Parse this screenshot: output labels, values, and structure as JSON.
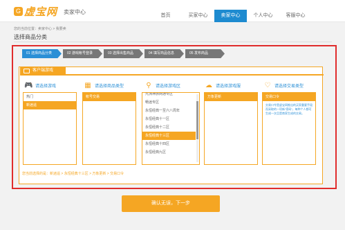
{
  "header": {
    "logo_glyph": "G",
    "logo_text": "虚宝网",
    "sub_title": "卖家中心",
    "nav": [
      {
        "label": "首页"
      },
      {
        "label": "买家中心"
      },
      {
        "label": "卖家中心",
        "active": true
      },
      {
        "label": "个人中心"
      },
      {
        "label": "客服中心"
      }
    ]
  },
  "breadcrumb": "您的当前位置：卖家中心 > 我要卖",
  "page_title": "选择商品分类",
  "steps": [
    {
      "label": "01 选择商品分类",
      "active": true
    },
    {
      "label": "02 游戏帐号登录"
    },
    {
      "label": "03 选择出售商品"
    },
    {
      "label": "04 填写商品信息"
    },
    {
      "label": "05 发布商品"
    }
  ],
  "tab": {
    "label": "客户端游戏"
  },
  "columns": {
    "game": {
      "title": "请选择游戏",
      "icon": "gamepad-icon",
      "glyph": "🎮",
      "items": [
        "热门",
        "新逍遥"
      ],
      "selected": 1
    },
    "category": {
      "title": "请选择商品类型",
      "icon": "grid-icon",
      "glyph": "▦",
      "items": [
        "帐号交易"
      ],
      "selected": 0
    },
    "region": {
      "title": "请选择游戏区",
      "icon": "location-pin-icon",
      "glyph": "⚲",
      "items": [
        "九洲神族网通专区",
        "畅逍专区",
        "永恒经典一至六八周年",
        "永恒经典十一区",
        "永恒经典十二区",
        "永恒经典十三区",
        "永恒经典十四区",
        "永恒经典九区"
      ],
      "selected": 5
    },
    "server": {
      "title": "请选择游戏服",
      "icon": "cloud-icon",
      "glyph": "☁",
      "items": [
        "万象更新"
      ],
      "selected": 0
    },
    "trade": {
      "title": "请选择交易类型",
      "icon": "heart-hand-icon",
      "glyph": "♡",
      "items": [
        "交易口令"
      ],
      "selected": 0,
      "description": "交易口令是虚宝网推出的买家重要手段而采取的一项新“密码”，每种个人都可生成一次且是商家生成的交易。"
    }
  },
  "selection_path": "您当前选择的是：新逍遥 > 永恒经典十三区 > 万象更新 > 交易口令",
  "confirm_button": "确认无误，下一步",
  "colors": {
    "accent": "#f5a623",
    "nav_active": "#1e8bd0",
    "highlight": "#e02c2c"
  }
}
